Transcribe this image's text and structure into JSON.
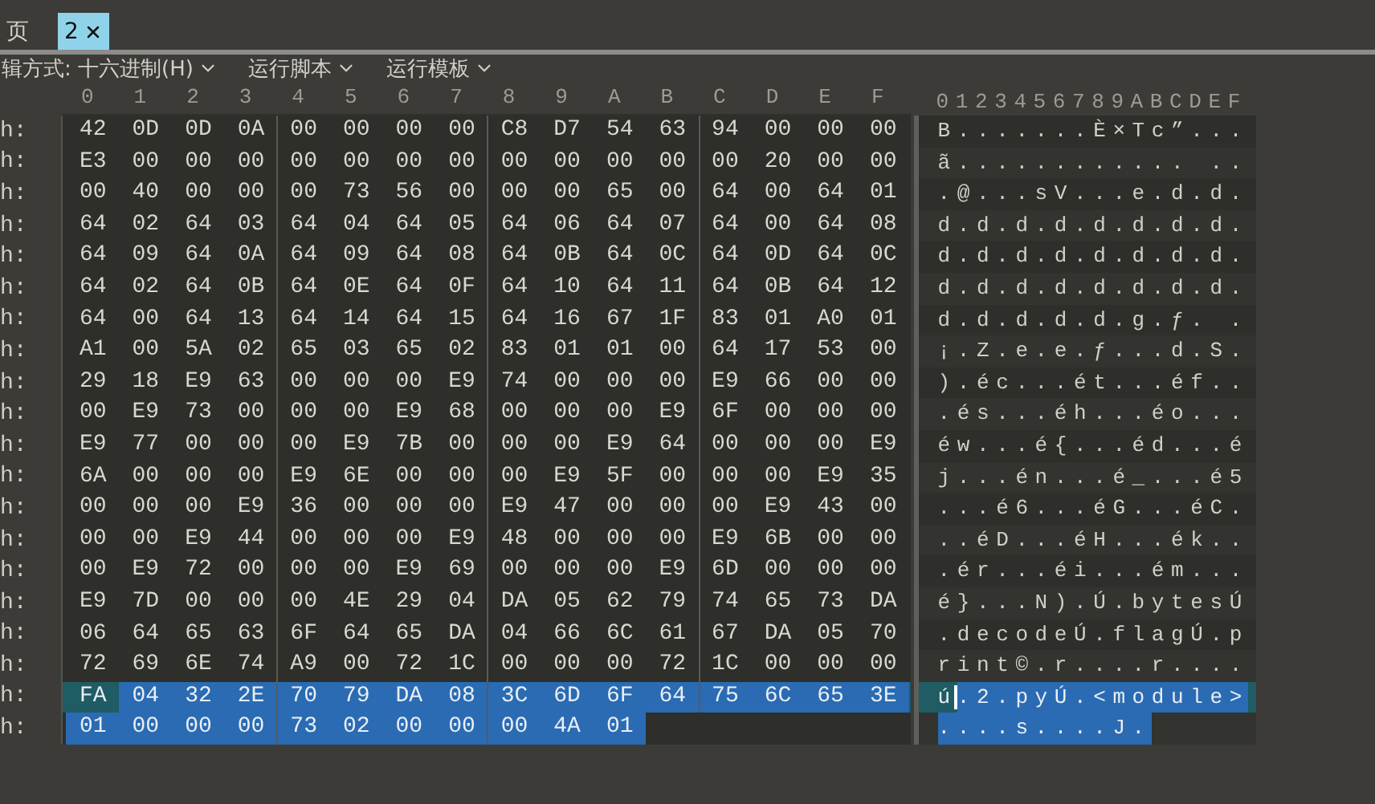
{
  "tabs": [
    {
      "label": "页",
      "selected": false,
      "closable": false
    },
    {
      "label": "2",
      "selected": true,
      "closable": true
    }
  ],
  "toolbar": {
    "items": [
      {
        "label": "辑方式: 十六进制(H)"
      },
      {
        "label": "运行脚本"
      },
      {
        "label": "运行模板"
      }
    ]
  },
  "editor": {
    "hex_header": [
      "0",
      "1",
      "2",
      "3",
      "4",
      "5",
      "6",
      "7",
      "8",
      "9",
      "A",
      "B",
      "C",
      "D",
      "E",
      "F"
    ],
    "text_header": "0123456789ABCDEF",
    "rows": [
      {
        "offset": "h:",
        "bytes": [
          "42",
          "0D",
          "0D",
          "0A",
          "00",
          "00",
          "00",
          "00",
          "C8",
          "D7",
          "54",
          "63",
          "94",
          "00",
          "00",
          "00"
        ],
        "text": "B.......È×Tc”...",
        "selected": false,
        "current": false
      },
      {
        "offset": "h:",
        "bytes": [
          "E3",
          "00",
          "00",
          "00",
          "00",
          "00",
          "00",
          "00",
          "00",
          "00",
          "00",
          "00",
          "00",
          "20",
          "00",
          "00"
        ],
        "text": "ã............ ..",
        "selected": false,
        "current": false
      },
      {
        "offset": "h:",
        "bytes": [
          "00",
          "40",
          "00",
          "00",
          "00",
          "73",
          "56",
          "00",
          "00",
          "00",
          "65",
          "00",
          "64",
          "00",
          "64",
          "01"
        ],
        "text": ".@...sV...e.d.d.",
        "selected": false,
        "current": false
      },
      {
        "offset": "h:",
        "bytes": [
          "64",
          "02",
          "64",
          "03",
          "64",
          "04",
          "64",
          "05",
          "64",
          "06",
          "64",
          "07",
          "64",
          "00",
          "64",
          "08"
        ],
        "text": "d.d.d.d.d.d.d.d.",
        "selected": false,
        "current": false
      },
      {
        "offset": "h:",
        "bytes": [
          "64",
          "09",
          "64",
          "0A",
          "64",
          "09",
          "64",
          "08",
          "64",
          "0B",
          "64",
          "0C",
          "64",
          "0D",
          "64",
          "0C"
        ],
        "text": "d.d.d.d.d.d.d.d.",
        "selected": false,
        "current": false
      },
      {
        "offset": "h:",
        "bytes": [
          "64",
          "02",
          "64",
          "0B",
          "64",
          "0E",
          "64",
          "0F",
          "64",
          "10",
          "64",
          "11",
          "64",
          "0B",
          "64",
          "12"
        ],
        "text": "d.d.d.d.d.d.d.d.",
        "selected": false,
        "current": false
      },
      {
        "offset": "h:",
        "bytes": [
          "64",
          "00",
          "64",
          "13",
          "64",
          "14",
          "64",
          "15",
          "64",
          "16",
          "67",
          "1F",
          "83",
          "01",
          "A0",
          "01"
        ],
        "text": "d.d.d.d.d.g.ƒ. .",
        "selected": false,
        "current": false
      },
      {
        "offset": "h:",
        "bytes": [
          "A1",
          "00",
          "5A",
          "02",
          "65",
          "03",
          "65",
          "02",
          "83",
          "01",
          "01",
          "00",
          "64",
          "17",
          "53",
          "00"
        ],
        "text": "¡.Z.e.e.ƒ...d.S.",
        "selected": false,
        "current": false
      },
      {
        "offset": "h:",
        "bytes": [
          "29",
          "18",
          "E9",
          "63",
          "00",
          "00",
          "00",
          "E9",
          "74",
          "00",
          "00",
          "00",
          "E9",
          "66",
          "00",
          "00"
        ],
        "text": ").éc...ét...éf..",
        "selected": false,
        "current": false
      },
      {
        "offset": "h:",
        "bytes": [
          "00",
          "E9",
          "73",
          "00",
          "00",
          "00",
          "E9",
          "68",
          "00",
          "00",
          "00",
          "E9",
          "6F",
          "00",
          "00",
          "00"
        ],
        "text": ".és...éh...éo...",
        "selected": false,
        "current": false
      },
      {
        "offset": "h:",
        "bytes": [
          "E9",
          "77",
          "00",
          "00",
          "00",
          "E9",
          "7B",
          "00",
          "00",
          "00",
          "E9",
          "64",
          "00",
          "00",
          "00",
          "E9"
        ],
        "text": "éw...é{...éd...é",
        "selected": false,
        "current": false
      },
      {
        "offset": "h:",
        "bytes": [
          "6A",
          "00",
          "00",
          "00",
          "E9",
          "6E",
          "00",
          "00",
          "00",
          "E9",
          "5F",
          "00",
          "00",
          "00",
          "E9",
          "35"
        ],
        "text": "j...én...é_...é5",
        "selected": false,
        "current": false
      },
      {
        "offset": "h:",
        "bytes": [
          "00",
          "00",
          "00",
          "E9",
          "36",
          "00",
          "00",
          "00",
          "E9",
          "47",
          "00",
          "00",
          "00",
          "E9",
          "43",
          "00"
        ],
        "text": "...é6...éG...éC.",
        "selected": false,
        "current": false
      },
      {
        "offset": "h:",
        "bytes": [
          "00",
          "00",
          "E9",
          "44",
          "00",
          "00",
          "00",
          "E9",
          "48",
          "00",
          "00",
          "00",
          "E9",
          "6B",
          "00",
          "00"
        ],
        "text": "..éD...éH...ék..",
        "selected": false,
        "current": false
      },
      {
        "offset": "h:",
        "bytes": [
          "00",
          "E9",
          "72",
          "00",
          "00",
          "00",
          "E9",
          "69",
          "00",
          "00",
          "00",
          "E9",
          "6D",
          "00",
          "00",
          "00"
        ],
        "text": ".ér...éi...ém...",
        "selected": false,
        "current": false
      },
      {
        "offset": "h:",
        "bytes": [
          "E9",
          "7D",
          "00",
          "00",
          "00",
          "4E",
          "29",
          "04",
          "DA",
          "05",
          "62",
          "79",
          "74",
          "65",
          "73",
          "DA"
        ],
        "text": "é}...N).Ú.bytesÚ",
        "selected": false,
        "current": false
      },
      {
        "offset": "h:",
        "bytes": [
          "06",
          "64",
          "65",
          "63",
          "6F",
          "64",
          "65",
          "DA",
          "04",
          "66",
          "6C",
          "61",
          "67",
          "DA",
          "05",
          "70"
        ],
        "text": ".decodeÚ.flagÚ.p",
        "selected": false,
        "current": false
      },
      {
        "offset": "h:",
        "bytes": [
          "72",
          "69",
          "6E",
          "74",
          "A9",
          "00",
          "72",
          "1C",
          "00",
          "00",
          "00",
          "72",
          "1C",
          "00",
          "00",
          "00"
        ],
        "text": "rint©.r....r....",
        "selected": false,
        "current": false
      },
      {
        "offset": "h:",
        "bytes": [
          "FA",
          "04",
          "32",
          "2E",
          "70",
          "79",
          "DA",
          "08",
          "3C",
          "6D",
          "6F",
          "64",
          "75",
          "6C",
          "65",
          "3E"
        ],
        "text": "ú.2.pyÚ.<module>",
        "selected": true,
        "current": true
      },
      {
        "offset": "h:",
        "bytes": [
          "01",
          "00",
          "00",
          "00",
          "73",
          "02",
          "00",
          "00",
          "00",
          "4A",
          "01"
        ],
        "text": "....s....J.",
        "selected": true,
        "current": false
      }
    ]
  }
}
